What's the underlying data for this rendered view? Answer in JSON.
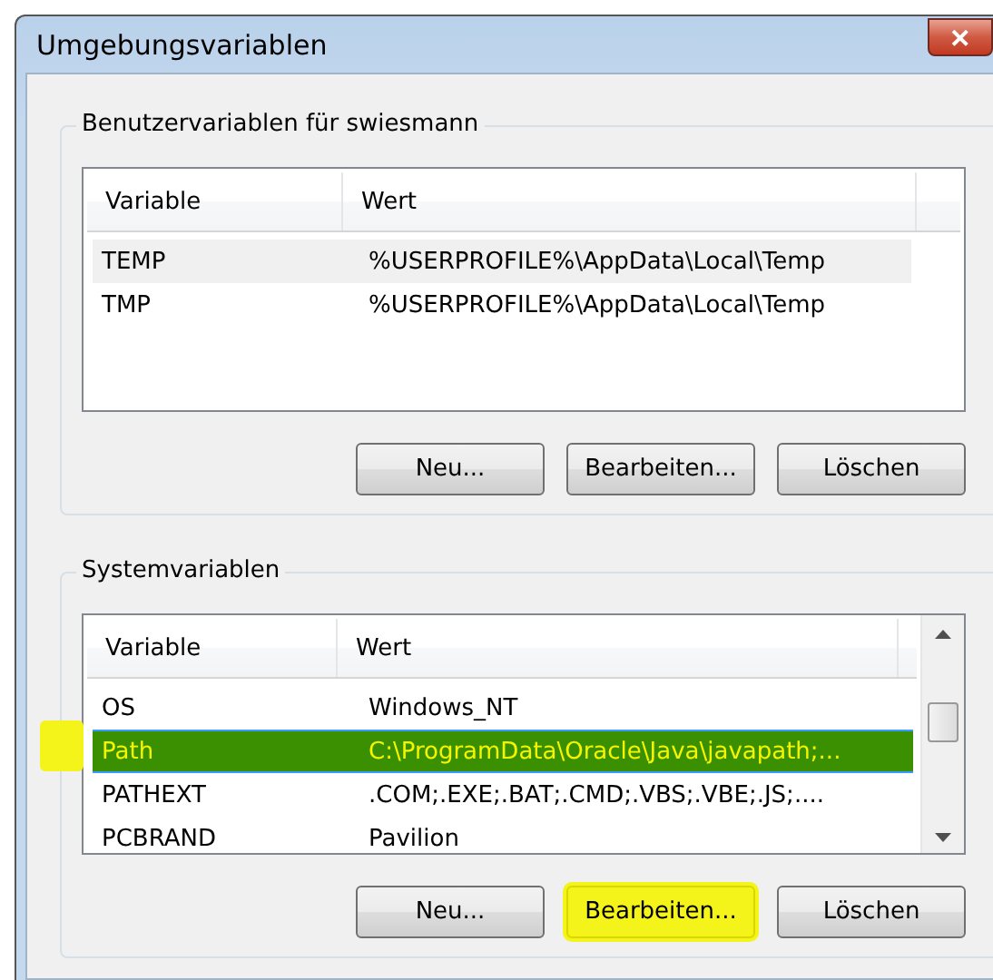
{
  "window": {
    "title": "Umgebungsvariablen",
    "close": "✕"
  },
  "groups": [
    {
      "title": "Benutzervariablen für swiesmann",
      "columns": [
        "Variable",
        "Wert"
      ],
      "scrollbar": false,
      "rows": [
        {
          "name": "TEMP",
          "value": "%USERPROFILE%\\AppData\\Local\\Temp",
          "selected": false,
          "hovered": true
        },
        {
          "name": "TMP",
          "value": "%USERPROFILE%\\AppData\\Local\\Temp",
          "selected": false,
          "hovered": false
        }
      ],
      "buttons": [
        {
          "label": "Neu...",
          "highlighted": false
        },
        {
          "label": "Bearbeiten...",
          "highlighted": false
        },
        {
          "label": "Löschen",
          "highlighted": false
        }
      ]
    },
    {
      "title": "Systemvariablen",
      "columns": [
        "Variable",
        "Wert"
      ],
      "scrollbar": true,
      "rows": [
        {
          "name": "OS",
          "value": "Windows_NT",
          "selected": false,
          "hovered": false
        },
        {
          "name": "Path",
          "value": "C:\\ProgramData\\Oracle\\Java\\javapath;...",
          "selected": true,
          "hovered": false
        },
        {
          "name": "PATHEXT",
          "value": ".COM;.EXE;.BAT;.CMD;.VBS;.VBE;.JS;....",
          "selected": false,
          "hovered": false
        },
        {
          "name": "PCBRAND",
          "value": "Pavilion",
          "selected": false,
          "hovered": false
        }
      ],
      "buttons": [
        {
          "label": "Neu...",
          "highlighted": false
        },
        {
          "label": "Bearbeiten...",
          "highlighted": true
        },
        {
          "label": "Löschen",
          "highlighted": false
        }
      ]
    }
  ]
}
